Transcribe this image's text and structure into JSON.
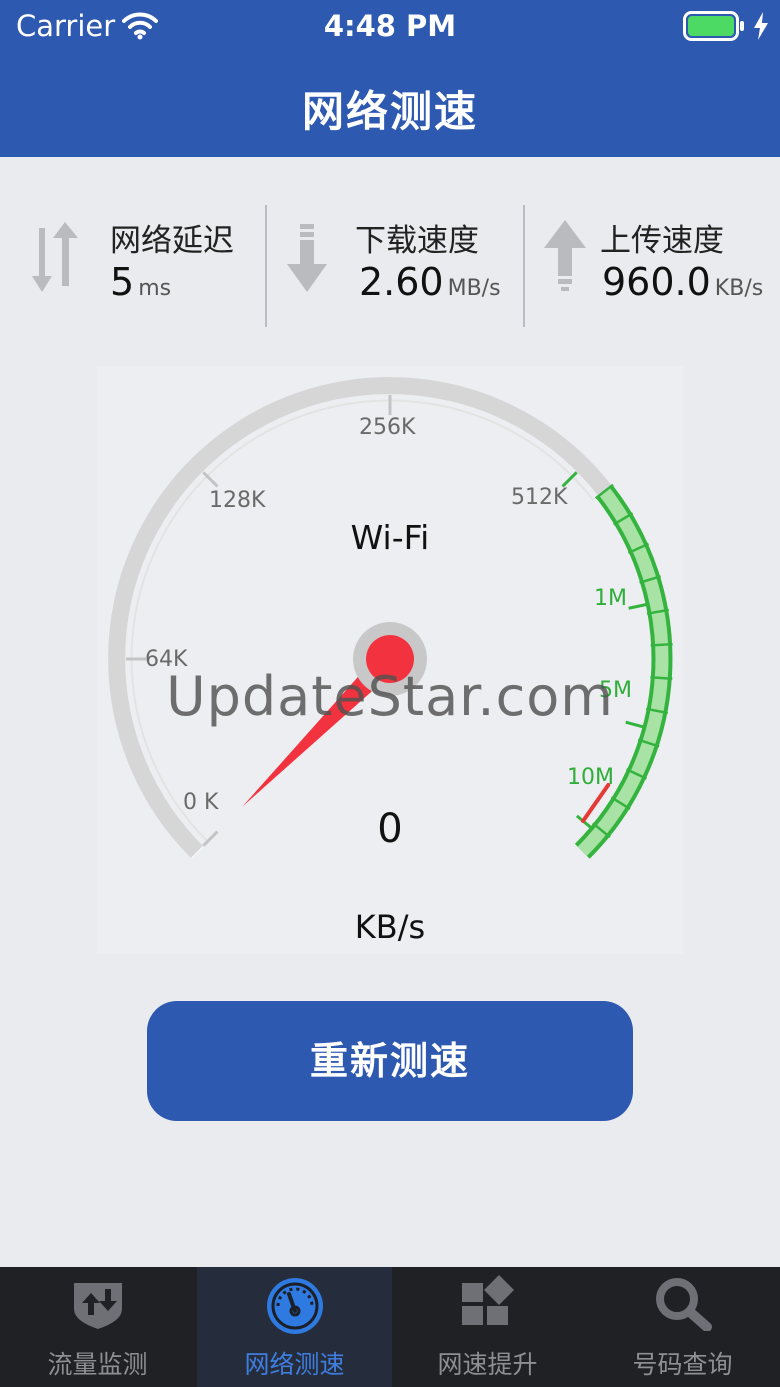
{
  "status_bar": {
    "carrier": "Carrier",
    "time": "4:48 PM"
  },
  "header": {
    "title": "网络测速"
  },
  "metrics": [
    {
      "label": "网络延迟",
      "value": "5",
      "unit": "ms",
      "icon": "latency-arrows-icon"
    },
    {
      "label": "下载速度",
      "value": "2.60",
      "unit": "MB/s",
      "icon": "download-arrow-icon"
    },
    {
      "label": "上传速度",
      "value": "960.0",
      "unit": "KB/s",
      "icon": "upload-arrow-icon"
    }
  ],
  "gauge": {
    "scale_labels": [
      "0 K",
      "64K",
      "128K",
      "256K",
      "512K",
      "1M",
      "5M",
      "10M"
    ],
    "network_type": "Wi-Fi",
    "speed_value": "0",
    "speed_unit": "KB/s",
    "needle_color": "#f2333f",
    "active_arc_color": "#35b33f",
    "inactive_arc_color": "#d6d6d6"
  },
  "watermark": "UpdateStar.com",
  "retest_button": {
    "label": "重新测速",
    "color": "#2e59b0"
  },
  "tab_bar": {
    "active_index": 1,
    "tabs": [
      {
        "label": "流量监测",
        "icon": "traffic-shield-icon"
      },
      {
        "label": "网络测速",
        "icon": "speedometer-icon"
      },
      {
        "label": "网速提升",
        "icon": "boost-grid-icon"
      },
      {
        "label": "号码查询",
        "icon": "magnifier-icon"
      }
    ]
  }
}
